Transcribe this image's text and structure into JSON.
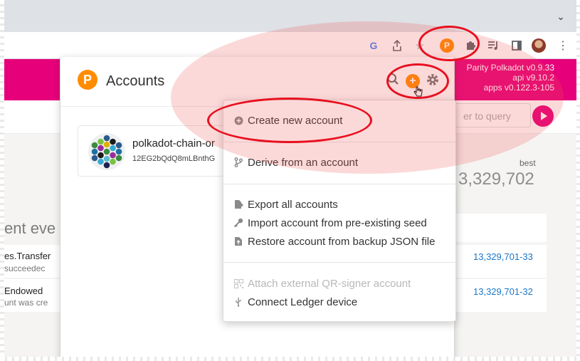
{
  "browser": {
    "toolbar_icons": [
      "google-icon",
      "share-icon",
      "star-icon",
      "polkadot-extension-icon",
      "puzzle-icon",
      "media-icon",
      "sidebar-icon",
      "profile-avatar",
      "kebab-menu-icon"
    ],
    "google_glyph": "G",
    "extension_glyph": "P"
  },
  "app": {
    "version_line1": "Parity Polkadot v0.9.33",
    "version_line2": "api v9.10.2",
    "version_line3": "apps v0.122.3-105",
    "query_placeholder": "er to query",
    "best_label": "best",
    "best_value": "3,329,702",
    "events_title": "ent eve",
    "events": [
      {
        "name": "es.Transfer",
        "desc": "succeedec",
        "block": "13,329,701-33"
      },
      {
        "name": "Endowed",
        "desc": "unt was cre",
        "block": "13,329,701-32"
      }
    ],
    "accent_color": "#e6007a"
  },
  "popup": {
    "logo_glyph": "P",
    "title": "Accounts",
    "account": {
      "name": "polkadot-chain-or",
      "address": "12EG2bQdQ8mLBnthG"
    },
    "accent_color": "#ff8c00"
  },
  "menu": {
    "items": [
      {
        "label": "Create new account",
        "icon": "plus-circle-icon",
        "disabled": false
      },
      {
        "label": "Derive from an account",
        "icon": "branch-icon",
        "disabled": false
      },
      {
        "label": "Export all accounts",
        "icon": "export-file-icon",
        "disabled": false
      },
      {
        "label": "Import account from pre-existing seed",
        "icon": "key-icon",
        "disabled": false
      },
      {
        "label": "Restore account from backup JSON file",
        "icon": "file-upload-icon",
        "disabled": false
      },
      {
        "label": "Attach external QR-signer account",
        "icon": "qr-icon",
        "disabled": true
      },
      {
        "label": "Connect Ledger device",
        "icon": "usb-icon",
        "disabled": false
      }
    ]
  }
}
